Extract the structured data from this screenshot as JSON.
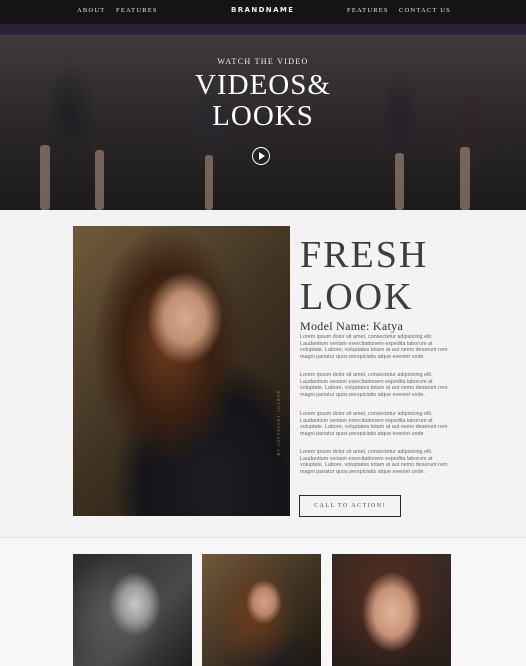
{
  "nav": {
    "left": [
      "ABOUT",
      "FEATURES"
    ],
    "brand": "BRANDNAME",
    "right": [
      "FEATURES",
      "CONTACT US"
    ]
  },
  "hero": {
    "kicker": "WATCH THE VIDEO",
    "title_line1": "VIDEOS&",
    "title_line2": "LOOKS",
    "play_icon": "play-icon"
  },
  "feature": {
    "photo_credit": "BY COPYRIGHT AUTHOR",
    "headline_line1": "FRESH",
    "headline_line2": "LOOK",
    "model_name": "Model Name: Katya",
    "paragraphs": [
      "Lorem ipsum dolor sit amet, consectetur adipisicing elit. Laudantium veniam exercitationem expedita laborum at voluptate. Labore, voluptates totam at aut nemo deserunt rem magni pariatur quos perspiciatis atque eveniet unde.",
      "Lorem ipsum dolor sit amet, consectetur adipisicing elit. Laudantium veniam exercitationem expedita laborum at voluptate. Labore, voluptates totam at aut nemo deserunt rem magni pariatur quos perspiciatis atque eveniet unde.",
      "Lorem ipsum dolor sit amet, consectetur adipisicing elit. Laudantium veniam exercitationem expedita laborum at voluptate. Labore, voluptates totam at aut nemo deserunt rem magni pariatur quos perspiciatis atque eveniet unde.",
      "Lorem ipsum dolor sit amet, consectetur adipisicing elit. Laudantium veniam exercitationem expedita laborum at voluptate. Labore, voluptates totam at aut nemo deserunt rem magni pariatur quos perspiciatis atque eveniet unde."
    ],
    "cta_label": "CALL TO ACTION!"
  },
  "colors": {
    "nav_bg": "#141414",
    "accent_band": "#2c2236",
    "page_bg": "#f3f3f3",
    "headline": "#3d3d3d"
  }
}
